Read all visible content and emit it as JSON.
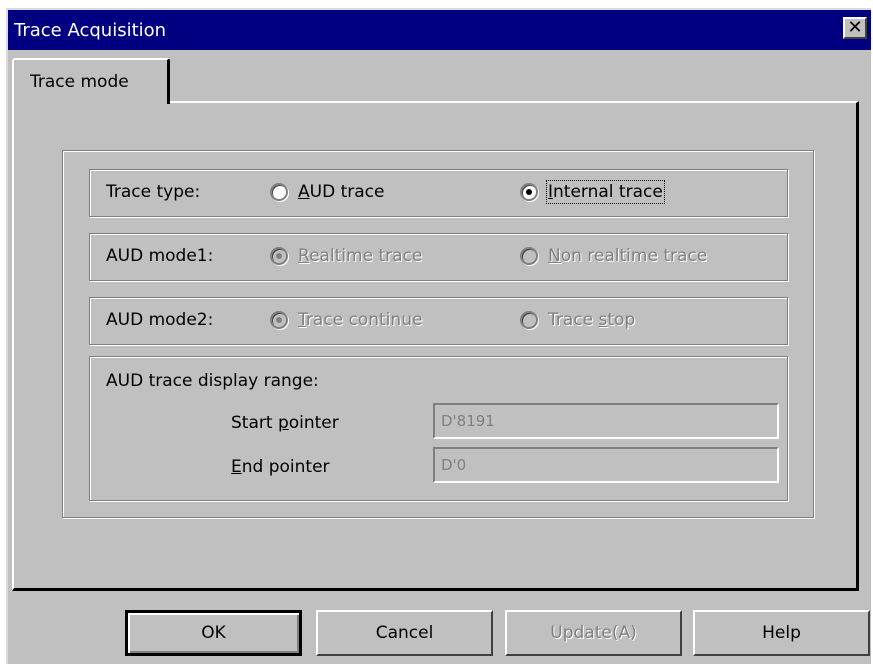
{
  "window": {
    "title": "Trace Acquisition",
    "close_glyph": "✕"
  },
  "tabs": [
    {
      "label": "Trace mode",
      "selected": true
    }
  ],
  "trace_type": {
    "label": "Trace type:",
    "options": [
      {
        "label": "AUD trace",
        "mnemonic": "A",
        "rest": "UD trace",
        "checked": false,
        "enabled": true
      },
      {
        "label": "Internal trace",
        "mnemonic": "I",
        "rest": "nternal trace",
        "checked": true,
        "enabled": true
      }
    ]
  },
  "aud_mode1": {
    "label": "AUD mode1:",
    "options": [
      {
        "label": "Realtime trace",
        "mnemonic": "R",
        "rest": "ealtime trace",
        "checked": true,
        "enabled": false
      },
      {
        "label": "Non realtime trace",
        "mnemonic": "N",
        "rest": "on realtime trace",
        "checked": false,
        "enabled": false
      }
    ]
  },
  "aud_mode2": {
    "label": "AUD mode2:",
    "options": [
      {
        "label": "Trace continue",
        "mnemonic": "T",
        "rest": "race continue",
        "checked": true,
        "enabled": false
      },
      {
        "label": "Trace stop",
        "pre": "Trace ",
        "mnemonic": "s",
        "rest": "top",
        "checked": false,
        "enabled": false
      }
    ]
  },
  "display_range": {
    "label": "AUD trace display range:",
    "start": {
      "pre": "Start ",
      "mnemonic": "p",
      "rest": "ointer",
      "value": "D'8191"
    },
    "end": {
      "mnemonic": "E",
      "rest": "nd pointer",
      "value": "D'0"
    }
  },
  "buttons": {
    "ok": "OK",
    "cancel": "Cancel",
    "update": "Update(A)",
    "help": "Help"
  },
  "colors": {
    "face": "#c0c0c0",
    "titlebar": "#000080",
    "disabled_text": "#808080"
  }
}
